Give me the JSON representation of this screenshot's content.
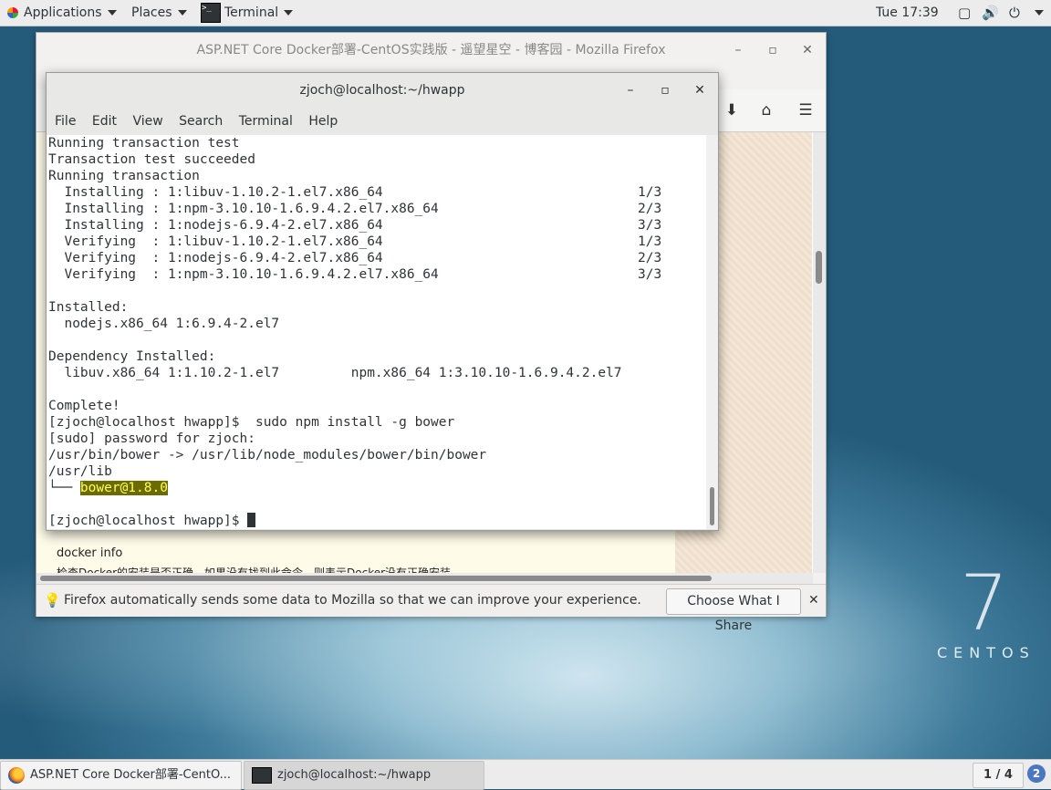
{
  "topbar": {
    "applications": "Applications",
    "places": "Places",
    "active_app": "Terminal",
    "clock": "Tue 17:39"
  },
  "firefox": {
    "title": "ASP.NET Core Docker部署-CentOS实践版 - 遥望星空 - 博客园 - Mozilla Firefox",
    "page_text_1": "docker info",
    "page_text_2": "检查Docker的安装是否正确，如果没有找到此命令，则表示Docker没有正确安装",
    "notification": "Firefox automatically sends some data to Mozilla so that we can improve your experience.",
    "choose_button": "Choose What I Share"
  },
  "terminal": {
    "title": "zjoch@localhost:~/hwapp",
    "menu": [
      "File",
      "Edit",
      "View",
      "Search",
      "Terminal",
      "Help"
    ],
    "lines": [
      "Running transaction test",
      "Transaction test succeeded",
      "Running transaction",
      "  Installing : 1:libuv-1.10.2-1.el7.x86_64                                1/3",
      "  Installing : 1:npm-3.10.10-1.6.9.4.2.el7.x86_64                         2/3",
      "  Installing : 1:nodejs-6.9.4-2.el7.x86_64                                3/3",
      "  Verifying  : 1:libuv-1.10.2-1.el7.x86_64                                1/3",
      "  Verifying  : 1:nodejs-6.9.4-2.el7.x86_64                                2/3",
      "  Verifying  : 1:npm-3.10.10-1.6.9.4.2.el7.x86_64                         3/3",
      "",
      "Installed:",
      "  nodejs.x86_64 1:6.9.4-2.el7",
      "",
      "Dependency Installed:",
      "  libuv.x86_64 1:1.10.2-1.el7         npm.x86_64 1:3.10.10-1.6.9.4.2.el7",
      "",
      "Complete!",
      "[zjoch@localhost hwapp]$  sudo npm install -g bower",
      "[sudo] password for zjoch:",
      "/usr/bin/bower -> /usr/lib/node_modules/bower/bin/bower",
      "/usr/lib"
    ],
    "tree_prefix": "└── ",
    "tree_pkg": "bower@1.8.0",
    "prompt": "[zjoch@localhost hwapp]$ "
  },
  "desktop": {
    "logo_numeral": "7",
    "logo_word": "CENTOS"
  },
  "taskbar": {
    "firefox_task": "ASP.NET Core Docker部署-CentO...",
    "terminal_task": "zjoch@localhost:~/hwapp",
    "pager": "1 / 4",
    "workspace": "2"
  },
  "colors": {
    "highlight_bg": "#6b6b00",
    "highlight_fg": "#ffff55",
    "topbar_bg": "#ececec"
  }
}
